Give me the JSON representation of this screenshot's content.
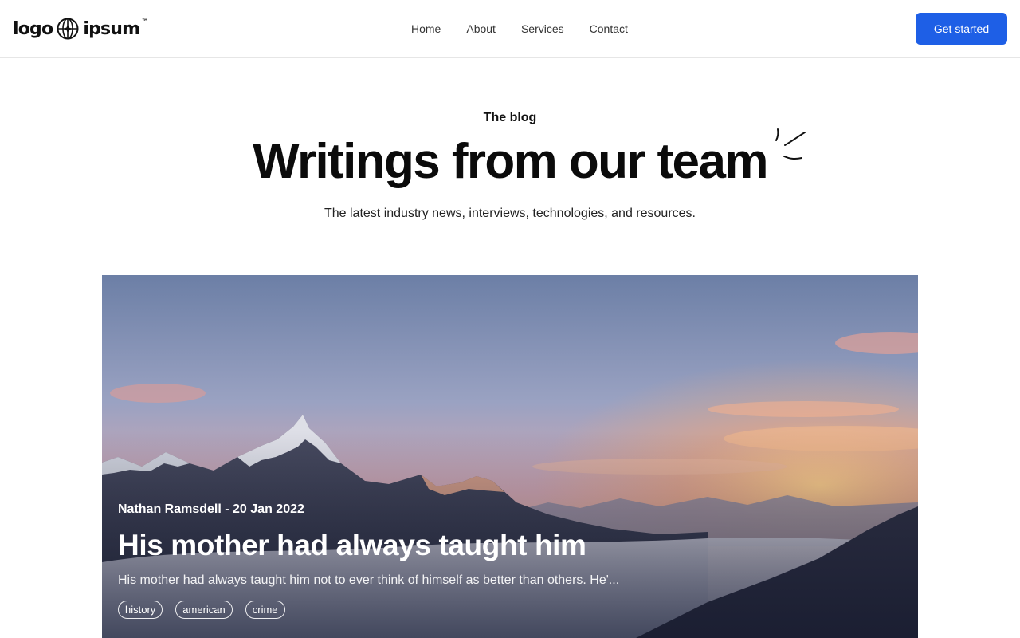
{
  "header": {
    "logo_text_left": "logo",
    "logo_text_right": "ipsum",
    "logo_trademark": "™",
    "nav": [
      {
        "label": "Home"
      },
      {
        "label": "About"
      },
      {
        "label": "Services"
      },
      {
        "label": "Contact"
      }
    ],
    "cta_label": "Get started",
    "cta_color": "#1e5fe6"
  },
  "hero": {
    "eyebrow": "The blog",
    "title": "Writings from our team",
    "subtitle": "The latest industry news, interviews, technologies, and resources."
  },
  "featured_post": {
    "author_date": "Nathan Ramsdell - 20 Jan 2022",
    "title": "His mother had always taught him",
    "excerpt": "His mother had always taught him not to ever think of himself as better than others. He'...",
    "tags": [
      "history",
      "american",
      "crime"
    ],
    "image_icon": "mountain-sunset-photo"
  }
}
